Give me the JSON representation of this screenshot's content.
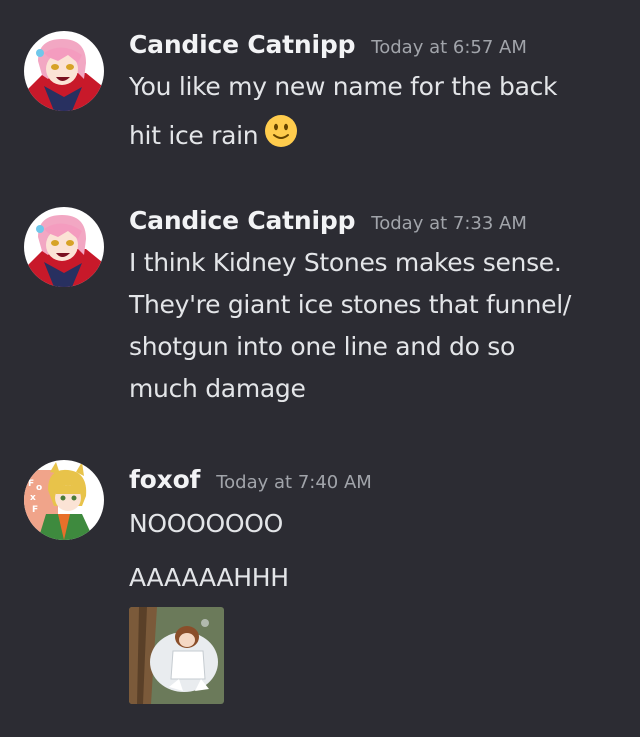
{
  "messages": [
    {
      "username": "Candice Catnipp",
      "timestamp": "Today at 6:57 AM",
      "avatar_icon": "anime-character-pink-hair-avatar",
      "lines": [
        "You like my new name for the back",
        "hit ice rain"
      ],
      "emoji": "slightly-smiling-face-emoji"
    },
    {
      "username": "Candice Catnipp",
      "timestamp": "Today at 7:33 AM",
      "avatar_icon": "anime-character-pink-hair-avatar",
      "lines": [
        "I think Kidney Stones makes sense.",
        "They're giant ice stones that funnel/",
        "shotgun into one line and do so",
        "much damage"
      ]
    },
    {
      "username": "foxof",
      "timestamp": "Today at 7:40 AM",
      "avatar_icon": "anime-character-blonde-hair-avatar",
      "lines": [
        "NOOOOOOO",
        "AAAAAAHHH"
      ],
      "attachment_icon": "sleeping-character-gif"
    }
  ],
  "colors": {
    "background": "#2c2c33",
    "username": "#f2f3f5",
    "timestamp": "#a1a4aa",
    "message_text": "#e3e5e8"
  }
}
